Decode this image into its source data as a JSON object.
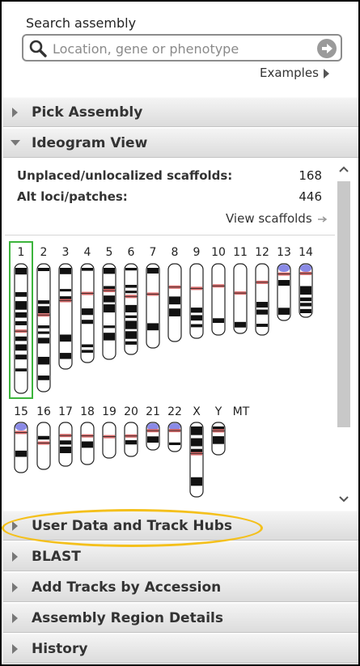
{
  "search": {
    "label": "Search assembly",
    "placeholder": "Location, gene or phenotype",
    "value": "",
    "examples_label": "Examples"
  },
  "sections": {
    "pick_assembly": "Pick Assembly",
    "ideogram_view": "Ideogram View",
    "user_data": "User Data and Track Hubs",
    "blast": "BLAST",
    "add_tracks": "Add Tracks by Accession",
    "region_details": "Assembly Region Details",
    "history": "History"
  },
  "ideogram": {
    "unplaced_label": "Unplaced/unlocalized scaffolds:",
    "unplaced_value": "168",
    "alt_label": "Alt loci/patches:",
    "alt_value": "446",
    "view_scaffolds": "View scaffolds",
    "selected_chromosome": "1",
    "chromosomes_row1": [
      "1",
      "2",
      "3",
      "4",
      "5",
      "6",
      "7",
      "8",
      "9",
      "10",
      "11",
      "12",
      "13",
      "14"
    ],
    "chromosomes_row2": [
      "15",
      "16",
      "17",
      "18",
      "19",
      "20",
      "21",
      "22",
      "X",
      "Y",
      "MT"
    ]
  },
  "colors": {
    "highlight": "#f4c01c",
    "selection": "#3cb43c",
    "centromere": "#d96a6a",
    "heterochromatin": "#8a8ae6"
  },
  "icons": {
    "search": "search-icon",
    "go": "arrow-right-circle-icon",
    "collapsed": "triangle-right-icon",
    "expanded": "triangle-down-icon"
  }
}
